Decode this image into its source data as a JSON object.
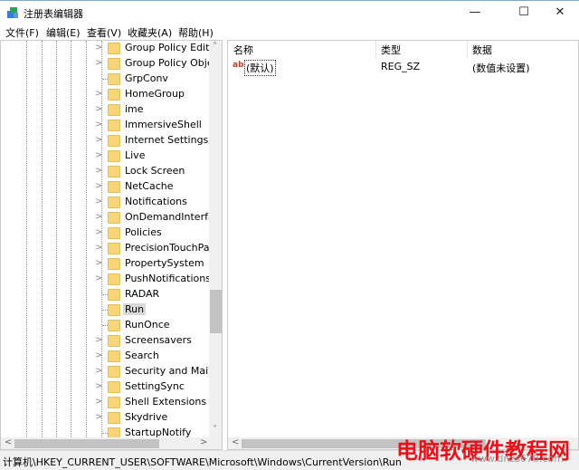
{
  "window": {
    "title": "注册表编辑器",
    "minimize": "—",
    "maximize": "☐",
    "close": "✕"
  },
  "menu": [
    "文件(F)",
    "编辑(E)",
    "查看(V)",
    "收藏夹(A)",
    "帮助(H)"
  ],
  "tree": {
    "items": [
      {
        "label": "Group Policy Editor",
        "expandable": true
      },
      {
        "label": "Group Policy Objec",
        "expandable": true
      },
      {
        "label": "GrpConv",
        "expandable": false
      },
      {
        "label": "HomeGroup",
        "expandable": true
      },
      {
        "label": "ime",
        "expandable": true
      },
      {
        "label": "ImmersiveShell",
        "expandable": true
      },
      {
        "label": "Internet Settings",
        "expandable": true
      },
      {
        "label": "Live",
        "expandable": true
      },
      {
        "label": "Lock Screen",
        "expandable": true
      },
      {
        "label": "NetCache",
        "expandable": true
      },
      {
        "label": "Notifications",
        "expandable": true
      },
      {
        "label": "OnDemandInterface",
        "expandable": true
      },
      {
        "label": "Policies",
        "expandable": true
      },
      {
        "label": "PrecisionTouchPad",
        "expandable": true
      },
      {
        "label": "PropertySystem",
        "expandable": true
      },
      {
        "label": "PushNotifications",
        "expandable": true
      },
      {
        "label": "RADAR",
        "expandable": false
      },
      {
        "label": "Run",
        "expandable": false,
        "selected": true
      },
      {
        "label": "RunOnce",
        "expandable": false
      },
      {
        "label": "Screensavers",
        "expandable": true
      },
      {
        "label": "Search",
        "expandable": true
      },
      {
        "label": "Security and Mainte",
        "expandable": true
      },
      {
        "label": "SettingSync",
        "expandable": true
      },
      {
        "label": "Shell Extensions",
        "expandable": true
      },
      {
        "label": "Skydrive",
        "expandable": true
      },
      {
        "label": "StartupNotify",
        "expandable": false
      }
    ]
  },
  "values": {
    "headers": {
      "name": "名称",
      "type": "类型",
      "data": "数据"
    },
    "rows": [
      {
        "icon": "ab",
        "name": "(默认)",
        "type": "REG_SZ",
        "data": "(数值未设置)"
      }
    ]
  },
  "status": "计算机\\HKEY_CURRENT_USER\\SOFTWARE\\Microsoft\\Windows\\CurrentVersion\\Run",
  "watermark": {
    "title": "电脑软硬件教程网",
    "url": "www.dnzs678.com"
  }
}
